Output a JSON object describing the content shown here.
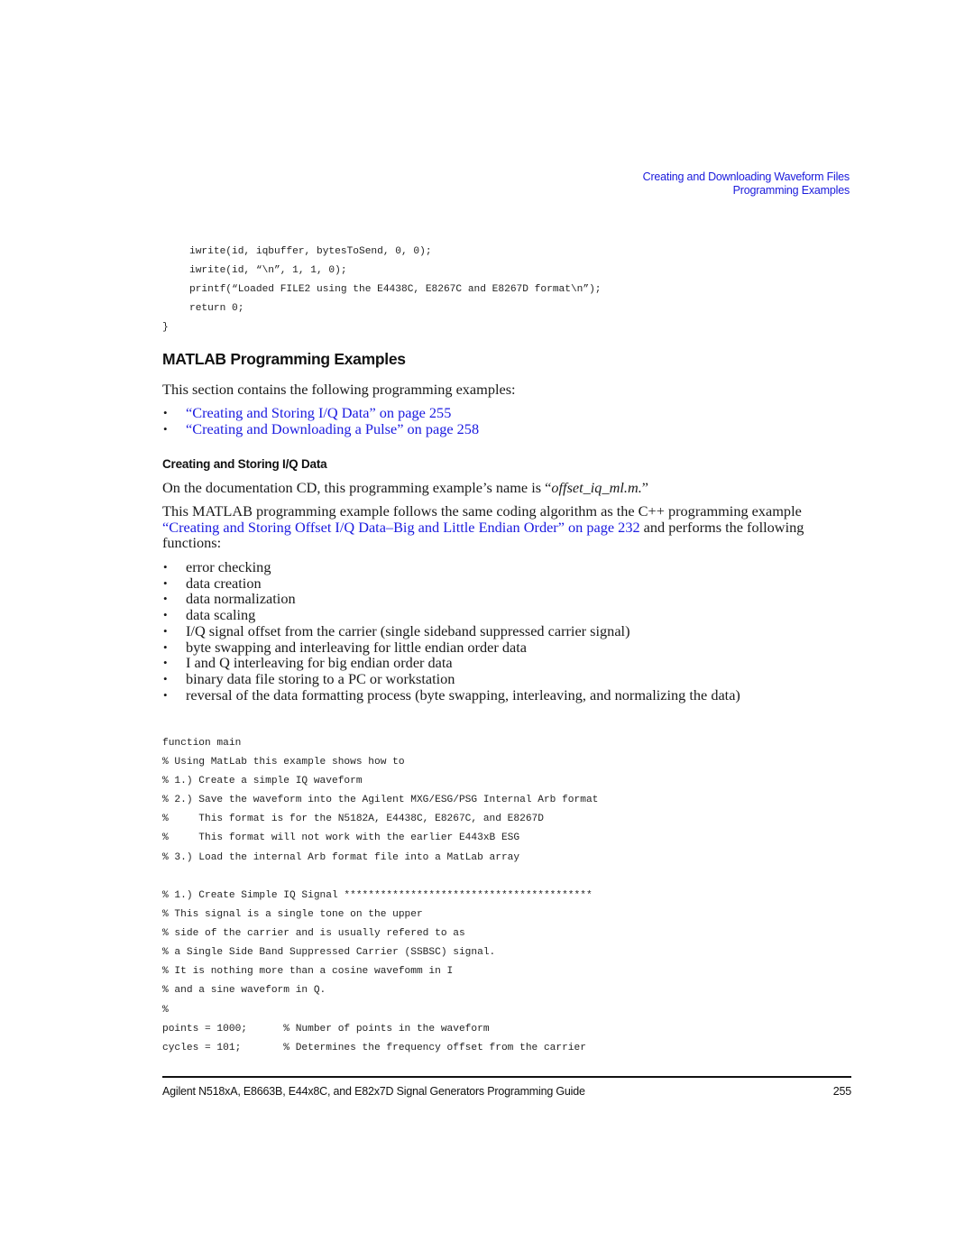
{
  "running_header": {
    "chapter": "Creating and Downloading Waveform Files",
    "section": "Programming Examples"
  },
  "code_top": {
    "lines": [
      "iwrite(id, iqbuffer, bytesToSend, 0, 0);",
      "iwrite(id, “\\n”, 1, 1, 0);",
      "printf(“Loaded FILE2 using the E4438C, E8267C and E8267D format\\n”);",
      "return 0;",
      "}"
    ]
  },
  "section": {
    "title": "MATLAB Programming Examples",
    "intro": "This section contains the following programming examples:",
    "toc": [
      "“Creating and Storing I/Q Data” on page 255",
      "“Creating and Downloading a Pulse” on page 258"
    ]
  },
  "subsection": {
    "title": "Creating and Storing I/Q Data",
    "name_para_prefix": "On the documentation CD, this programming example’s name is “",
    "name_para_filename": "offset_iq_ml.m.",
    "name_para_suffix": "”",
    "algo_para_prefix": "This MATLAB programming example follows the same coding algorithm as the C++ programming example ",
    "algo_para_link": "“Creating and Storing Offset I/Q Data–Big and Little Endian Order” on page 232",
    "algo_para_suffix": " and performs the following functions:",
    "functions": [
      "error checking",
      "data creation",
      "data normalization",
      "data scaling",
      "I/Q signal offset from the carrier (single sideband suppressed carrier signal)",
      "byte swapping and interleaving for little endian order data",
      "I and Q interleaving for big endian order data",
      "binary data file storing to a PC or workstation",
      "reversal of the data formatting process (byte swapping, interleaving, and normalizing the data)"
    ]
  },
  "code_main": {
    "lines": [
      "function main",
      "% Using MatLab this example shows how to",
      "% 1.) Create a simple IQ waveform",
      "% 2.) Save the waveform into the Agilent MXG/ESG/PSG Internal Arb format",
      "%     This format is for the N5182A, E4438C, E8267C, and E8267D",
      "%     This format will not work with the earlier E443xB ESG",
      "% 3.) Load the internal Arb format file into a MatLab array"
    ]
  },
  "code_signal": {
    "lines": [
      "% 1.) Create Simple IQ Signal *****************************************",
      "% This signal is a single tone on the upper",
      "% side of the carrier and is usually refered to as",
      "% a Single Side Band Suppressed Carrier (SSBSC) signal.",
      "% It is nothing more than a cosine wavefomm in I",
      "% and a sine waveform in Q.",
      "%",
      "points = 1000;      % Number of points in the waveform",
      "cycles = 101;       % Determines the frequency offset from the carrier"
    ]
  },
  "footer": {
    "title": "Agilent N518xA, E8663B, E44x8C, and E82x7D Signal Generators Programming Guide",
    "page_number": "255"
  },
  "colors": {
    "link": "#1a1ae0",
    "header": "#1a1adc",
    "text": "#1a1a1a"
  }
}
